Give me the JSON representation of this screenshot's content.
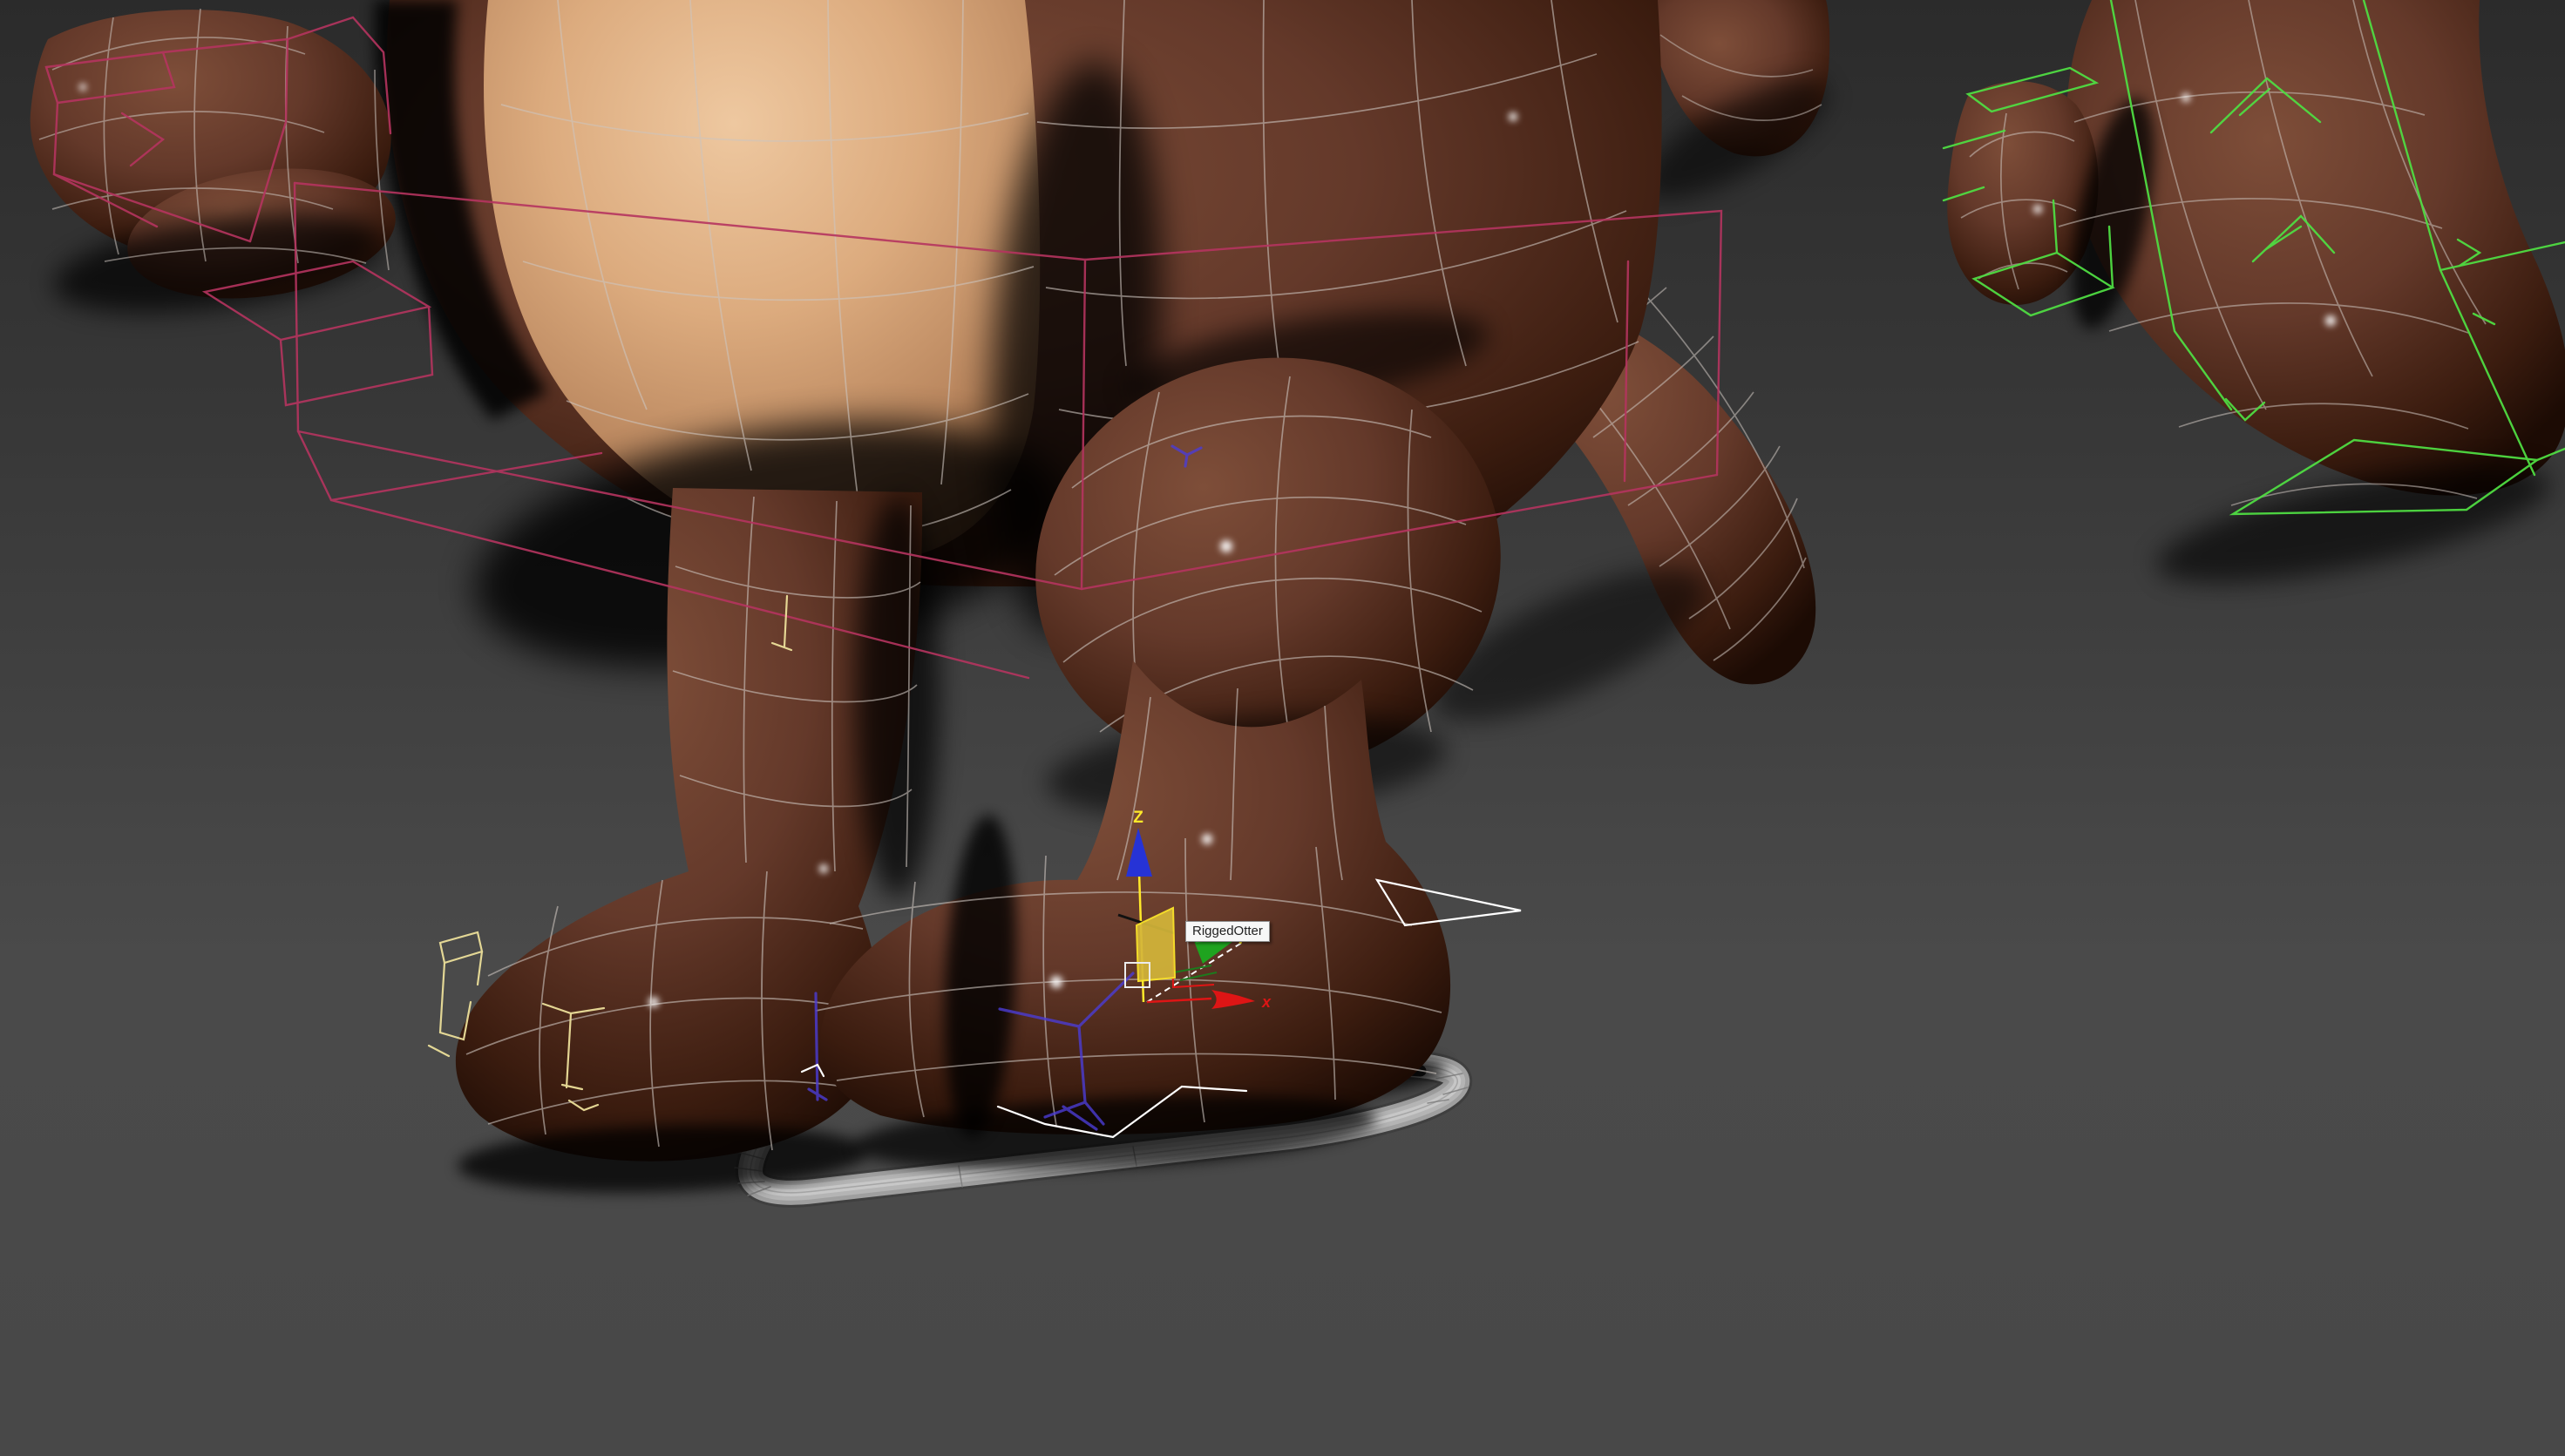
{
  "tooltip": {
    "label": "RiggedOtter"
  },
  "gizmo": {
    "z_label": "Z",
    "x_label": "x"
  },
  "colors": {
    "bg_top": "#2b2b2b",
    "bg_upper": "#383838",
    "bg_mid": "#4a4a4a",
    "bg_bottom": "#484848",
    "fur_light": "#7e4e39",
    "fur": "#64392a",
    "fur_shadow": "#3b1c0f",
    "fur_deep": "#1c0b04",
    "belly_light": "#eec8a0",
    "belly": "#dcab7e",
    "belly_shadow": "#b8855d",
    "belly_deep": "#7c5130",
    "mesh_wire": "#cdc5bf",
    "bone_pink": "#b5345f",
    "bone_green": "#4fdc42",
    "bone_yellow": "#ecdf9a",
    "bone_blue": "#4b3cd4",
    "bone_selected": "#ffffff",
    "skate_outline": "#3f3f3f",
    "skate_mid": "#9f9f9f",
    "skate_face": "#b4b4b4",
    "skate_highlight": "#c9c9c9",
    "gizmo_x": "#de1515",
    "gizmo_y": "#1fa31f",
    "gizmo_y_light": "#35d435",
    "gizmo_z": "#2633d6",
    "gizmo_active": "#ffe92a",
    "gizmo_plane_fill": "#d4b63a",
    "tooltip_bg": "#f7f7f7",
    "tooltip_border": "#8f8f8f",
    "tooltip_text": "#222222"
  }
}
